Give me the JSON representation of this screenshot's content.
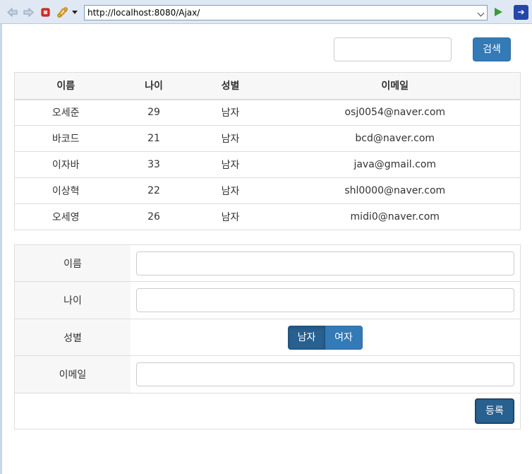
{
  "browser": {
    "url": "http://localhost:8080/Ajax/"
  },
  "search": {
    "value": "",
    "button_label": "검색"
  },
  "table": {
    "headers": [
      "이름",
      "나이",
      "성별",
      "이메일"
    ],
    "rows": [
      [
        "오세준",
        "29",
        "남자",
        "osj0054@naver.com"
      ],
      [
        "바코드",
        "21",
        "남자",
        "bcd@naver.com"
      ],
      [
        "이자바",
        "33",
        "남자",
        "java@gmail.com"
      ],
      [
        "이상혁",
        "22",
        "남자",
        "shl0000@naver.com"
      ],
      [
        "오세영",
        "26",
        "남자",
        "midi0@naver.com"
      ]
    ]
  },
  "form": {
    "name_label": "이름",
    "age_label": "나이",
    "gender_label": "성별",
    "email_label": "이메일",
    "name_value": "",
    "age_value": "",
    "email_value": "",
    "gender_options": [
      "남자",
      "여자"
    ],
    "gender_selected": "남자",
    "submit_label": "등록"
  },
  "colors": {
    "primary": "#337ab7",
    "primary_active": "#286090",
    "toolbar_bg": "#dfe8f3"
  }
}
